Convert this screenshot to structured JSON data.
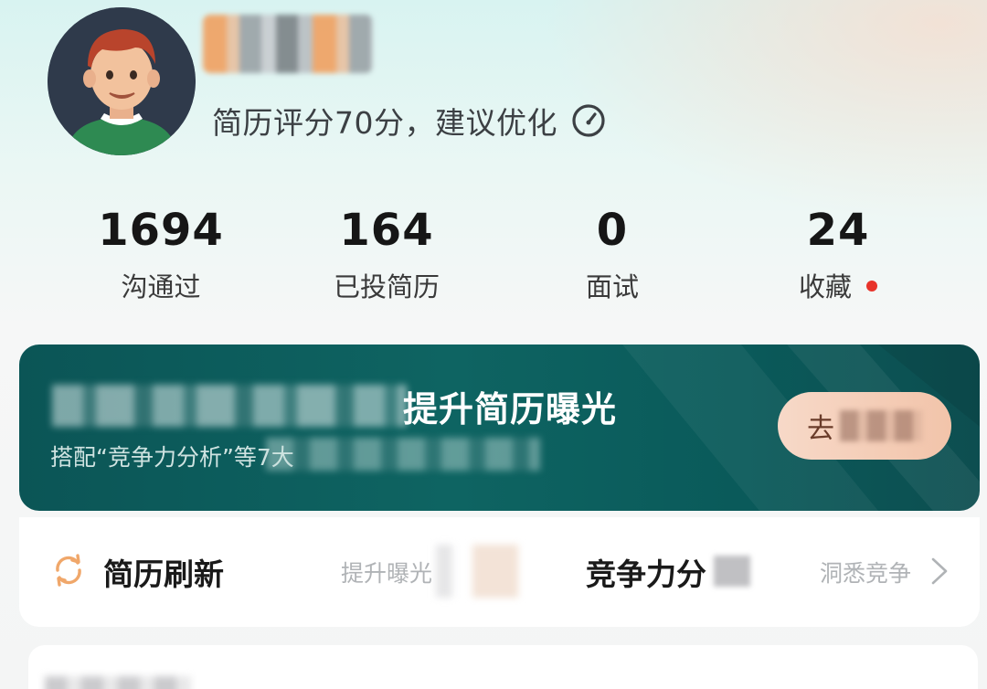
{
  "profile": {
    "score_text": "简历评分70分，建议优化"
  },
  "stats": [
    {
      "value": "1694",
      "label": "沟通过"
    },
    {
      "value": "164",
      "label": "已投简历"
    },
    {
      "value": "0",
      "label": "面试"
    },
    {
      "value": "24",
      "label": "收藏"
    }
  ],
  "banner": {
    "title_visible": "提升简历曝光",
    "subtitle_visible": "搭配“竞争力分析”等7大",
    "button_visible": "去"
  },
  "tools": {
    "refresh_title": "简历刷新",
    "refresh_sub": "提升曝光",
    "competition_title": "竞争力分",
    "competition_sub": "洞悉竞争"
  },
  "colors": {
    "banner_bg": "#0e6462",
    "accent_orange": "#f0a76a",
    "notice_red": "#e8342b"
  },
  "icons": {
    "score": "gauge-icon",
    "refresh": "refresh-icon",
    "more": "chevron-right-icon"
  }
}
